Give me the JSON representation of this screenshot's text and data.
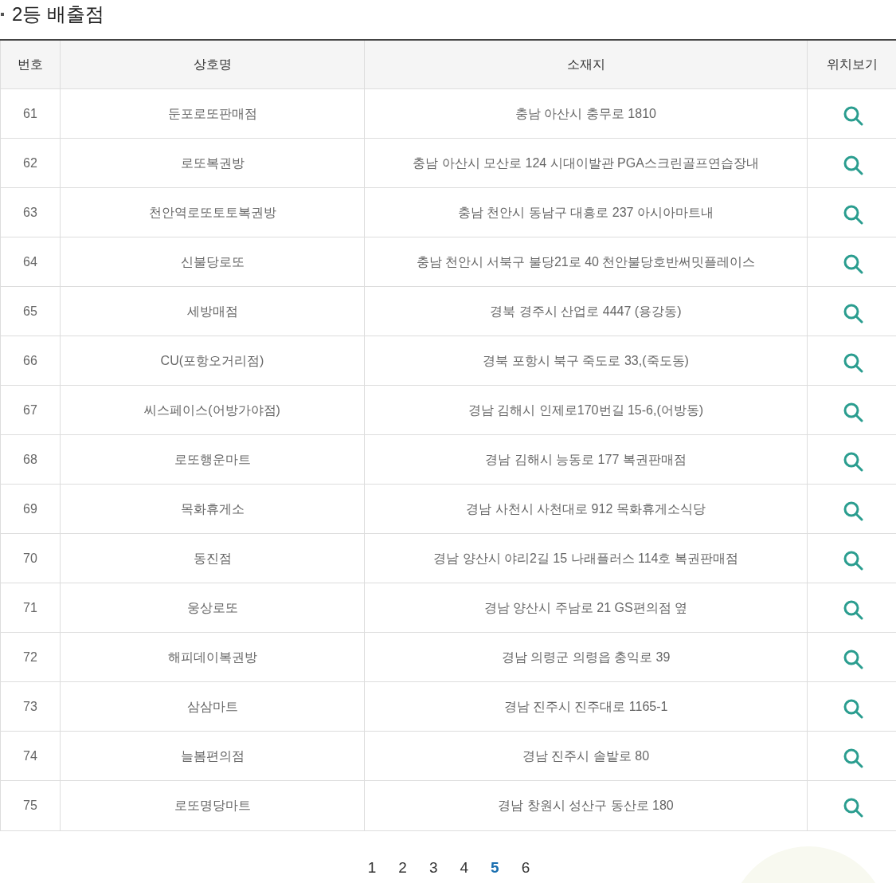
{
  "title": "2등 배출점",
  "table": {
    "columns": [
      "번호",
      "상호명",
      "소재지",
      "위치보기"
    ],
    "rows": [
      {
        "no": "61",
        "name": "둔포로또판매점",
        "address": "충남 아산시 충무로 1810"
      },
      {
        "no": "62",
        "name": "로또복권방",
        "address": "충남 아산시 모산로 124 시대이발관 PGA스크린골프연습장내"
      },
      {
        "no": "63",
        "name": "천안역로또토토복권방",
        "address": "충남 천안시 동남구 대흥로 237 아시아마트내"
      },
      {
        "no": "64",
        "name": "신불당로또",
        "address": "충남 천안시 서북구 불당21로 40 천안불당호반써밋플레이스"
      },
      {
        "no": "65",
        "name": "세방매점",
        "address": "경북 경주시 산업로 4447 (용강동)"
      },
      {
        "no": "66",
        "name": "CU(포항오거리점)",
        "address": "경북 포항시 북구 죽도로 33,(죽도동)"
      },
      {
        "no": "67",
        "name": "씨스페이스(어방가야점)",
        "address": "경남 김해시 인제로170번길 15-6,(어방동)"
      },
      {
        "no": "68",
        "name": "로또행운마트",
        "address": "경남 김해시 능동로 177 복권판매점"
      },
      {
        "no": "69",
        "name": "목화휴게소",
        "address": "경남 사천시 사천대로 912 목화휴게소식당"
      },
      {
        "no": "70",
        "name": "동진점",
        "address": "경남 양산시 야리2길 15 나래플러스 114호 복권판매점"
      },
      {
        "no": "71",
        "name": "웅상로또",
        "address": "경남 양산시 주남로 21 GS편의점 옆"
      },
      {
        "no": "72",
        "name": "해피데이복권방",
        "address": "경남 의령군 의령읍 충익로 39"
      },
      {
        "no": "73",
        "name": "삼삼마트",
        "address": "경남 진주시 진주대로 1165-1"
      },
      {
        "no": "74",
        "name": "늘봄편의점",
        "address": "경남 진주시 솔밭로 80"
      },
      {
        "no": "75",
        "name": "로또명당마트",
        "address": "경남 창원시 성산구 동산로 180"
      }
    ]
  },
  "pagination": [
    {
      "label": "1",
      "selected": false
    },
    {
      "label": "2",
      "selected": false
    },
    {
      "label": "3",
      "selected": false
    },
    {
      "label": "4",
      "selected": false
    },
    {
      "label": "5",
      "selected": true
    },
    {
      "label": "6",
      "selected": false
    }
  ]
}
